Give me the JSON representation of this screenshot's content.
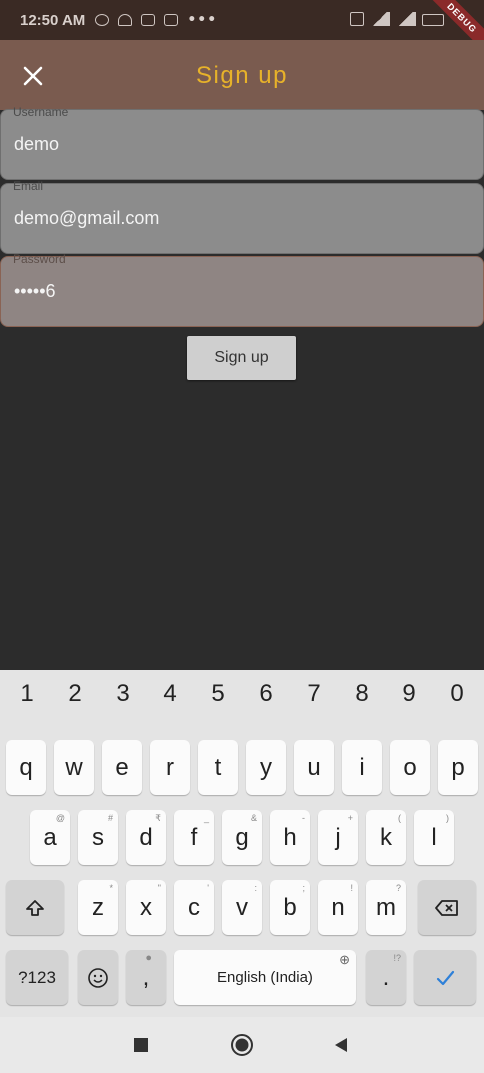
{
  "status_bar": {
    "time": "12:50 AM",
    "dots": "•••",
    "debug_label": "DEBUG"
  },
  "app_bar": {
    "title": "Sign up",
    "title_color": "#e7b22a",
    "close_icon": "close-icon"
  },
  "form": {
    "username": {
      "label": "Username",
      "value": "demo"
    },
    "email": {
      "label": "Email",
      "value": "demo@gmail.com"
    },
    "password": {
      "label": "Password",
      "value": "•••••6"
    },
    "submit_label": "Sign up"
  },
  "keyboard": {
    "numbers": [
      "1",
      "2",
      "3",
      "4",
      "5",
      "6",
      "7",
      "8",
      "9",
      "0"
    ],
    "row1": [
      "q",
      "w",
      "e",
      "r",
      "t",
      "y",
      "u",
      "i",
      "o",
      "p"
    ],
    "row2": [
      "a",
      "s",
      "d",
      "f",
      "g",
      "h",
      "j",
      "k",
      "l"
    ],
    "row2_hints": [
      "@",
      "#",
      "₹",
      "_",
      "&",
      "-",
      "+",
      "(",
      ")"
    ],
    "row3": [
      "z",
      "x",
      "c",
      "v",
      "b",
      "n",
      "m"
    ],
    "row3_hints": [
      "*",
      "\"",
      "'",
      ":",
      ";",
      "!",
      "?"
    ],
    "symbols_label": "?123",
    "comma": ",",
    "space_label": "English (India)",
    "period": ".",
    "period_hint": "!?"
  }
}
